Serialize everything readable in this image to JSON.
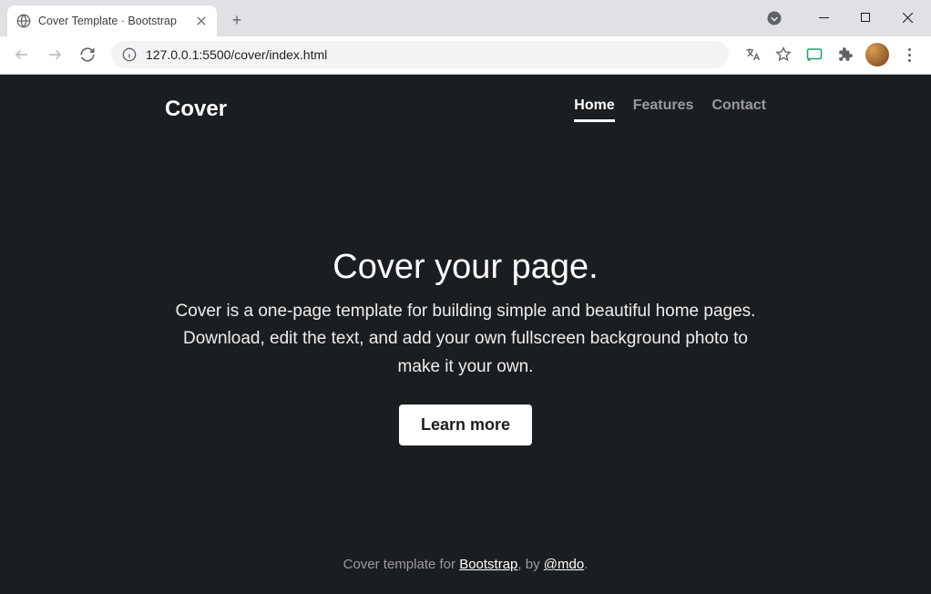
{
  "browser": {
    "tab_title": "Cover Template · Bootstrap",
    "url": "127.0.0.1:5500/cover/index.html"
  },
  "page": {
    "brand": "Cover",
    "nav": [
      {
        "label": "Home",
        "active": true
      },
      {
        "label": "Features",
        "active": false
      },
      {
        "label": "Contact",
        "active": false
      }
    ],
    "hero": {
      "title": "Cover your page.",
      "lead": "Cover is a one-page template for building simple and beautiful home pages. Download, edit the text, and add your own fullscreen background photo to make it your own.",
      "button": "Learn more"
    },
    "footer": {
      "prefix": "Cover template for ",
      "link1": "Bootstrap",
      "mid": ", by ",
      "link2": "@mdo",
      "suffix": "."
    }
  }
}
